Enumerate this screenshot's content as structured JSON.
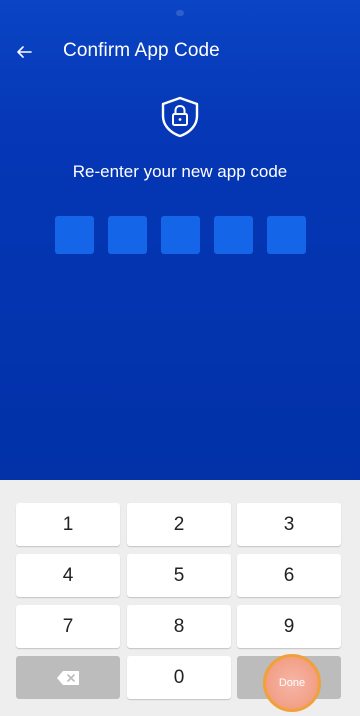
{
  "header": {
    "title": "Confirm App Code",
    "back_icon": "arrow-left-icon"
  },
  "main": {
    "shield_icon": "shield-lock-icon",
    "prompt": "Re-enter your new app code",
    "code_length": 5
  },
  "colors": {
    "background": "#0537b6",
    "code_box": "#1565e8",
    "done_button": "#f3a48f"
  },
  "keypad": {
    "keys": [
      "1",
      "2",
      "3",
      "4",
      "5",
      "6",
      "7",
      "8",
      "9",
      "0"
    ],
    "backspace_icon": "backspace-icon",
    "done_label": "Done"
  }
}
